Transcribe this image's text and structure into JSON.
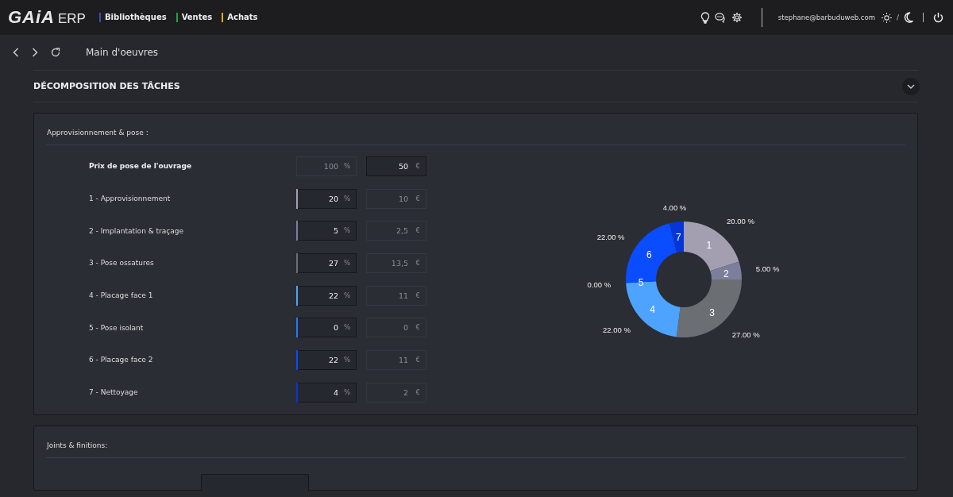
{
  "topbar": {
    "logo": "GAiA",
    "logo_suffix": "ERP",
    "nav": [
      {
        "label": "Bibliothèques",
        "color": "#2f4fbf"
      },
      {
        "label": "Ventes",
        "color": "#22a045"
      },
      {
        "label": "Achats",
        "color": "#e0a91a"
      }
    ],
    "user": "stephane@barbuduweb.com",
    "theme_separator": "/"
  },
  "page": {
    "title": "Main d'oeuvres"
  },
  "section": {
    "title": "DÉCOMPOSITION DES TÂCHES",
    "expanded": true
  },
  "cards": [
    {
      "title": "Approvisionnement & pose :",
      "total": {
        "label": "Prix de pose de l'ouvrage",
        "percent": {
          "value": "100",
          "unit": "%",
          "disabled": true
        },
        "amount": {
          "value": "50",
          "unit": "€",
          "disabled": false
        }
      },
      "rows": [
        {
          "label": "1 - Approvisionnement",
          "color": "#a39fb0",
          "percent": {
            "value": "20",
            "unit": "%",
            "disabled": false
          },
          "amount": {
            "value": "10",
            "unit": "€",
            "disabled": true
          }
        },
        {
          "label": "2 - Implantation & traçage",
          "color": "#7b7f9c",
          "percent": {
            "value": "5",
            "unit": "%",
            "disabled": false
          },
          "amount": {
            "value": "2,5",
            "unit": "€",
            "disabled": true
          }
        },
        {
          "label": "3 - Pose ossatures",
          "color": "#6b6e73",
          "percent": {
            "value": "27",
            "unit": "%",
            "disabled": false
          },
          "amount": {
            "value": "13,5",
            "unit": "€",
            "disabled": true
          }
        },
        {
          "label": "4 - Placage face 1",
          "color": "#4da3ff",
          "percent": {
            "value": "22",
            "unit": "%",
            "disabled": false
          },
          "amount": {
            "value": "11",
            "unit": "€",
            "disabled": true
          }
        },
        {
          "label": "5 - Pose isolant",
          "color": "#1e7bff",
          "percent": {
            "value": "0",
            "unit": "%",
            "disabled": false
          },
          "amount": {
            "value": "0",
            "unit": "€",
            "disabled": true
          }
        },
        {
          "label": "6 - Placage face 2",
          "color": "#0a4cff",
          "percent": {
            "value": "22",
            "unit": "%",
            "disabled": false
          },
          "amount": {
            "value": "11",
            "unit": "€",
            "disabled": true
          }
        },
        {
          "label": "7 - Nettoyage",
          "color": "#0537d6",
          "percent": {
            "value": "4",
            "unit": "%",
            "disabled": false
          },
          "amount": {
            "value": "2",
            "unit": "€",
            "disabled": true
          }
        }
      ],
      "chart_data": {
        "type": "donut",
        "categories": [
          "1",
          "2",
          "3",
          "4",
          "5",
          "6",
          "7"
        ],
        "series": [
          {
            "values": [
              20,
              5,
              27,
              22,
              0,
              22,
              4
            ]
          }
        ],
        "value_labels": [
          "20.00 %",
          "5.00 %",
          "27.00 %",
          "22.00 %",
          "0.00 %",
          "22.00 %",
          "4.00 %"
        ]
      }
    },
    {
      "title": "Joints & finitions:"
    }
  ]
}
